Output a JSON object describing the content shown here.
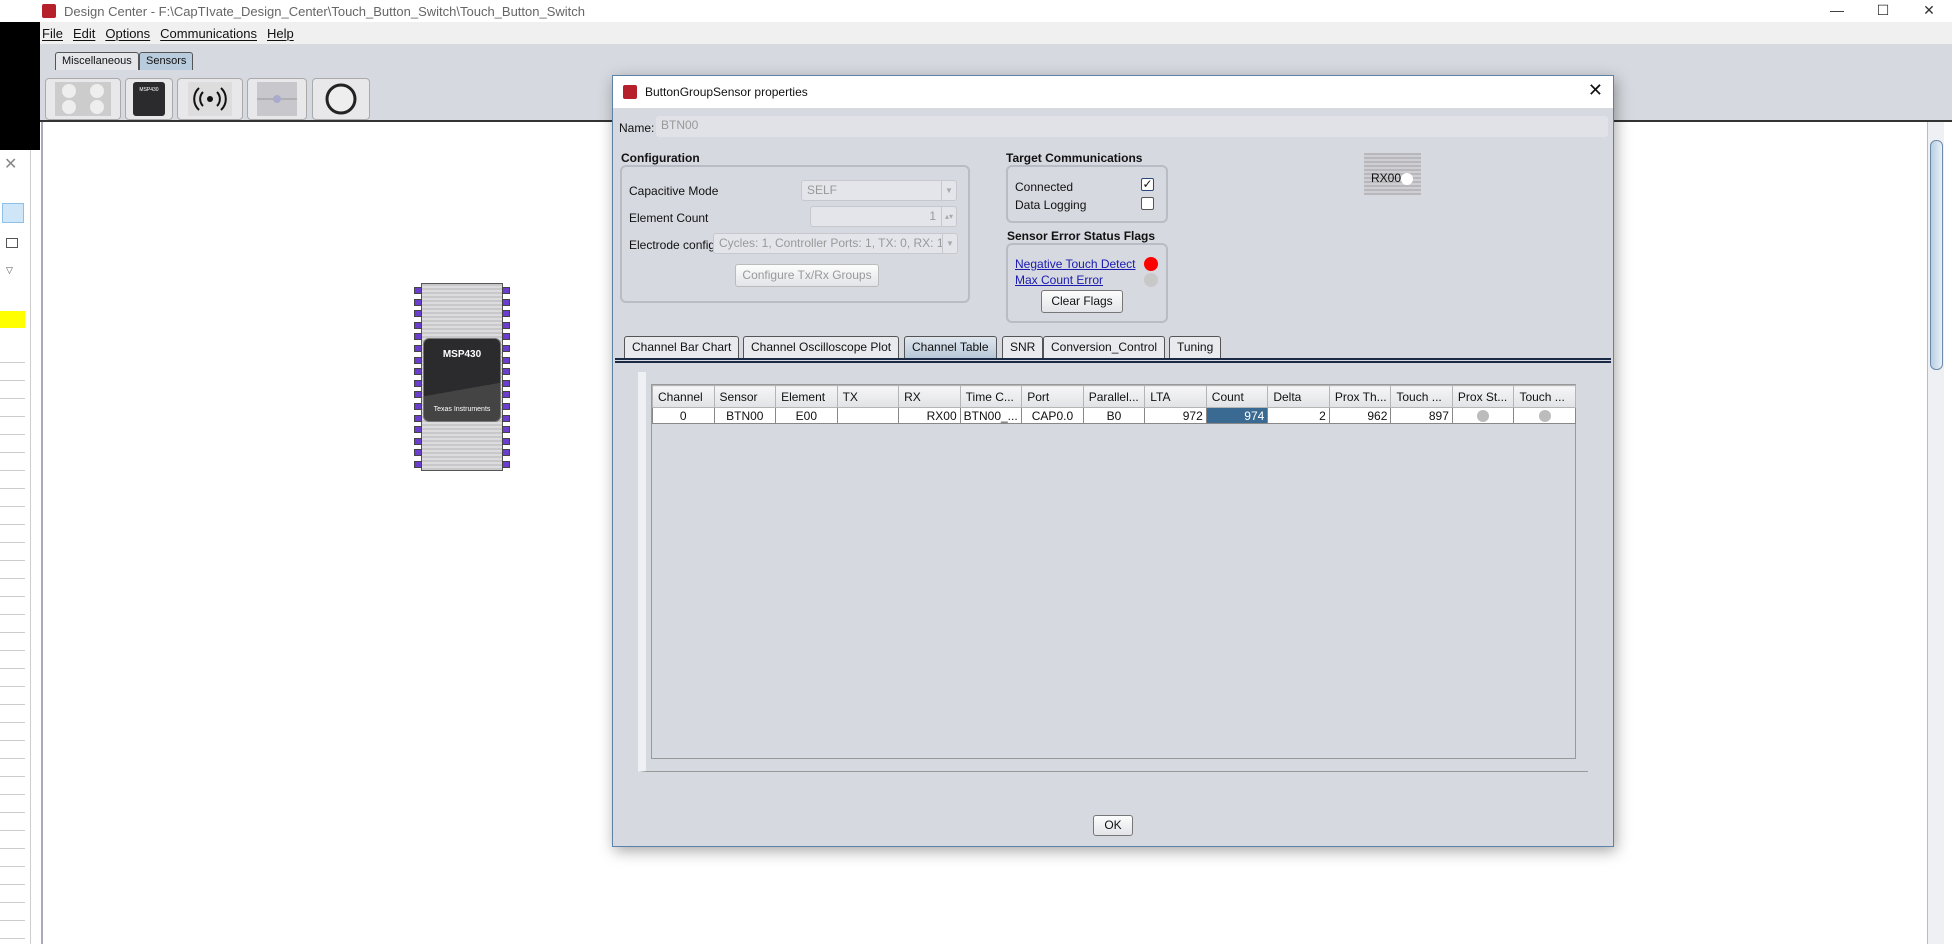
{
  "window": {
    "title": "Design Center - F:\\CapTIvate_Design_Center\\Touch_Button_Switch\\Touch_Button_Switch",
    "minimize": "—",
    "maximize": "☐",
    "close": "✕"
  },
  "menu": [
    "File",
    "Edit",
    "Options",
    "Communications",
    "Help"
  ],
  "palette": {
    "tabs": [
      "Miscellaneous",
      "Sensors"
    ],
    "active_tab": "Sensors",
    "chip_label": "MSP430"
  },
  "canvas": {
    "chip": {
      "label": "MSP430",
      "brand": "Texas Instruments"
    }
  },
  "left_panel": {
    "close": "✕"
  },
  "dialog": {
    "title": "ButtonGroupSensor properties",
    "close": "✕",
    "name_label": "Name:",
    "name_value": "BTN00",
    "configuration": {
      "heading": "Configuration",
      "capacitive_mode_label": "Capacitive Mode",
      "capacitive_mode_value": "SELF",
      "element_count_label": "Element Count",
      "element_count_value": "1",
      "electrode_config_label": "Electrode config",
      "electrode_config_value": "Cycles:  1, Controller Ports:  1, TX:  0, RX:  1",
      "configure_button": "Configure Tx/Rx Groups"
    },
    "target_comm": {
      "heading": "Target Communications",
      "connected_label": "Connected",
      "connected": true,
      "data_logging_label": "Data Logging",
      "data_logging": false
    },
    "error_flags": {
      "heading": "Sensor Error Status Flags",
      "negative_touch_label": "Negative Touch Detect",
      "negative_touch_color": "#ff0000",
      "max_count_label": "Max Count Error",
      "max_count_color": "#c8c8c8",
      "clear_button": "Clear Flags"
    },
    "rx_widget": "RX00",
    "tabs": [
      "Channel Bar Chart",
      "Channel Oscilloscope Plot",
      "Channel Table",
      "SNR",
      "Conversion_Control",
      "Tuning"
    ],
    "active_tab": "Channel Table",
    "table": {
      "columns": [
        "Channel",
        "Sensor",
        "Element",
        "TX",
        "RX",
        "Time C...",
        "Port",
        "Parallel...",
        "LTA",
        "Count",
        "Delta",
        "Prox Th...",
        "Touch ...",
        "Prox St...",
        "Touch ..."
      ],
      "rows": [
        {
          "channel": "0",
          "sensor": "BTN00",
          "element": "E00",
          "tx": "",
          "rx": "RX00",
          "time": "BTN00_...",
          "port": "CAP0.0",
          "parallel": "B0",
          "lta": "972",
          "count": "974",
          "delta": "2",
          "prox_th": "962",
          "touch_th": "897"
        }
      ]
    },
    "ok_button": "OK"
  }
}
